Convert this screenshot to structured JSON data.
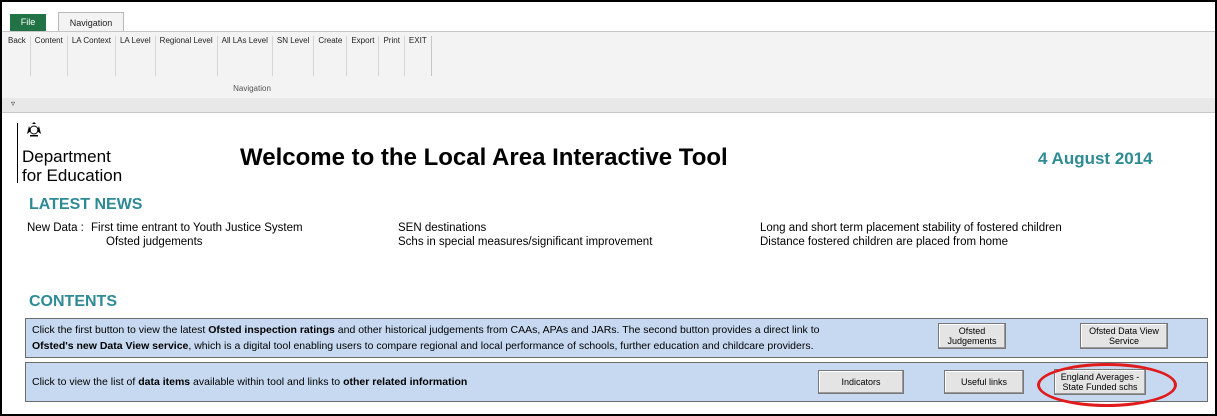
{
  "ribbon": {
    "tabs": {
      "file": "File",
      "navigation": "Navigation"
    },
    "items": [
      "Back",
      "Content",
      "LA Context",
      "LA Level",
      "Regional Level",
      "All LAs Level",
      "SN Level",
      "Create",
      "Export",
      "Print",
      "EXIT"
    ],
    "group_label": "Navigation",
    "collapse_icon": "▿"
  },
  "header": {
    "department_line1": "Department",
    "department_line2": "for Education",
    "title": "Welcome to the Local Area Interactive Tool",
    "date": "4 August 2014"
  },
  "news": {
    "heading": "LATEST NEWS",
    "label": "New Data :",
    "col1": [
      "First time entrant to Youth Justice System",
      "Ofsted judgements"
    ],
    "col2": [
      "SEN destinations",
      "Schs in special measures/significant improvement"
    ],
    "col3": [
      "Long and short term placement stability of fostered children",
      "Distance fostered children are placed from home"
    ]
  },
  "contents": {
    "heading": "CONTENTS",
    "panel1": {
      "t1": "Click the first button to view the latest ",
      "b1": "Ofsted inspection ratings",
      "t2": " and other historical judgements from CAAs, APAs and JARs.  The second button provides a direct link to",
      "b2": "Ofsted's new Data View service",
      "t3": ", which is a digital tool enabling users to compare regional and local performance of schools, further education and childcare providers.",
      "btn_judgements": "Ofsted Judgements",
      "btn_dataview": "Ofsted Data View Service"
    },
    "panel2": {
      "t1": "Click to view the list of ",
      "b1": "data items",
      "t2": " available within tool and links to ",
      "b2": "other related information",
      "btn_indicators": "Indicators",
      "btn_links": "Useful links",
      "btn_england": "England Averages - State Funded schs"
    }
  },
  "colors": {
    "accent": "#2e8a94",
    "panel": "#c6d9f1",
    "highlight_circle": "#e01b1b",
    "file_tab": "#217346"
  }
}
